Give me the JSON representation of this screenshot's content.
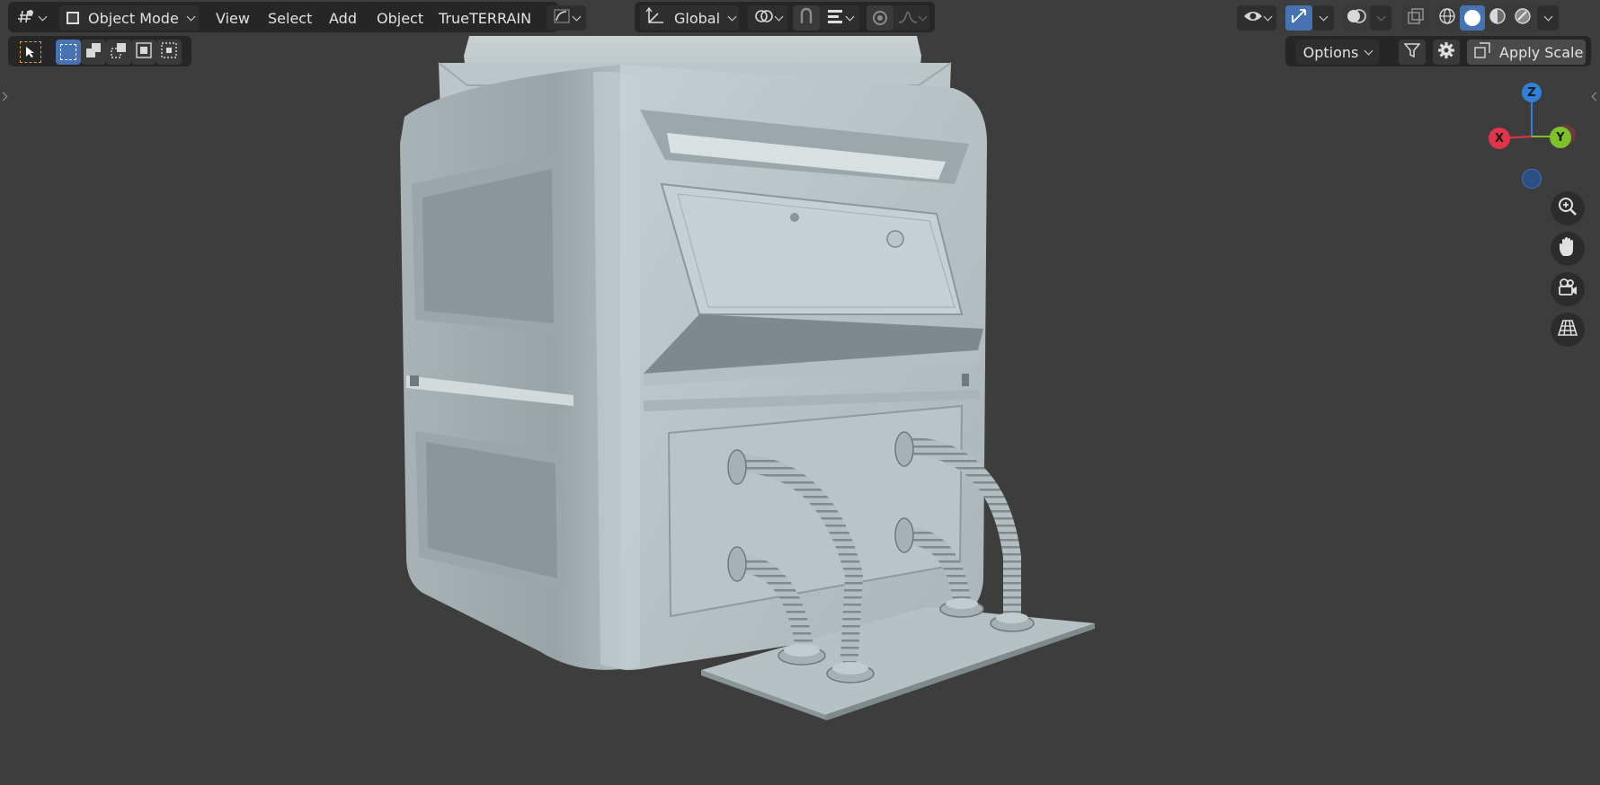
{
  "header": {
    "mode_label": "Object Mode",
    "menus": [
      "View",
      "Select",
      "Add",
      "Object",
      "TrueTERRAIN"
    ],
    "transform_orientation": "Global",
    "options_label": "Options",
    "apply_scale_label": "Apply Scale"
  },
  "gizmo": {
    "x_label": "X",
    "y_label": "Y",
    "z_label": "Z"
  },
  "icons": {
    "editor_type": "editor-type-icon",
    "mode": "object-mode-icon",
    "select_tool": "select-box-tool-icon",
    "orientation": "transform-orientation-icon",
    "pivot": "pivot-point-icon",
    "snap": "snap-icon",
    "proportional": "proportional-editing-icon",
    "visibility": "visibility-eye-icon",
    "gizmo_toggle": "gizmo-toggle-icon",
    "overlays": "overlays-icon",
    "xray": "xray-icon",
    "filter": "filter-icon",
    "gear": "gear-icon",
    "zoom": "zoom-icon",
    "pan": "hand-pan-icon",
    "camera": "camera-view-icon",
    "ortho": "ortho-grid-icon"
  },
  "colors": {
    "viewport_bg": "#3d3d3d",
    "header_bg": "#282828",
    "accent_blue": "#4772b3",
    "axis_x": "#e0344a",
    "axis_y": "#7ec22a",
    "axis_z": "#2f80d8",
    "model": "#b5c0c3"
  }
}
